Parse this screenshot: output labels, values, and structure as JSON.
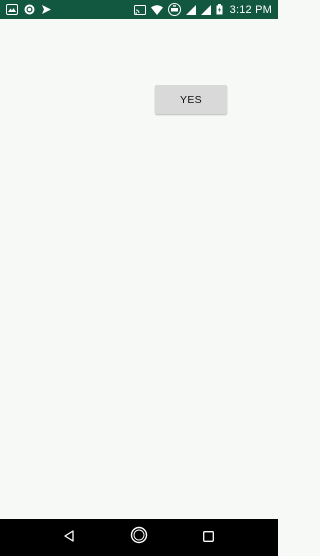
{
  "status_bar": {
    "time": "3:12 PM",
    "background": "#12573f",
    "left_icons": [
      "gallery-icon",
      "circle-app-icon",
      "send-app-icon"
    ],
    "right_icons": [
      "cast-icon",
      "wifi-icon",
      "volte-icon",
      "signal-icon",
      "signal-icon-2",
      "battery-icon"
    ]
  },
  "main": {
    "yes_button_label": "YES"
  },
  "nav_bar": {
    "buttons": [
      "back-icon",
      "home-icon",
      "recents-icon"
    ]
  },
  "colors": {
    "accent": "#12573f",
    "background": "#f7f9f7",
    "button": "#d8d9d8"
  }
}
